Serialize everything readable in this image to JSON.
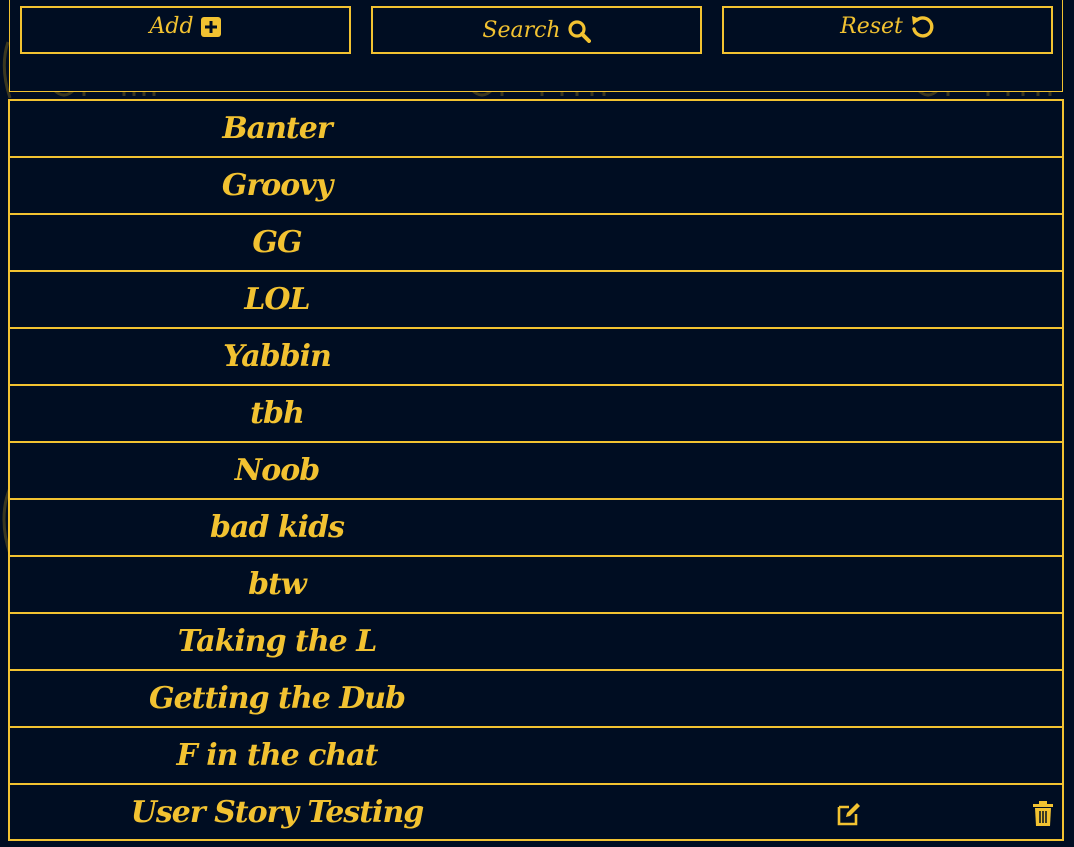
{
  "toolbar": {
    "add_label": "Add",
    "search_label": "Search",
    "reset_label": "Reset"
  },
  "items": [
    {
      "label": "Banter"
    },
    {
      "label": "Groovy"
    },
    {
      "label": "GG"
    },
    {
      "label": "LOL"
    },
    {
      "label": "Yabbin"
    },
    {
      "label": "tbh"
    },
    {
      "label": "Noob"
    },
    {
      "label": "bad kids"
    },
    {
      "label": "btw"
    },
    {
      "label": "Taking the L"
    },
    {
      "label": "Getting the Dub"
    },
    {
      "label": "F in the chat"
    },
    {
      "label": "User Story Testing"
    }
  ],
  "row_actions": {
    "edit_icon": "edit-icon",
    "delete_icon": "trash-icon"
  },
  "colors": {
    "background": "#000d22",
    "accent": "#f2c231"
  }
}
